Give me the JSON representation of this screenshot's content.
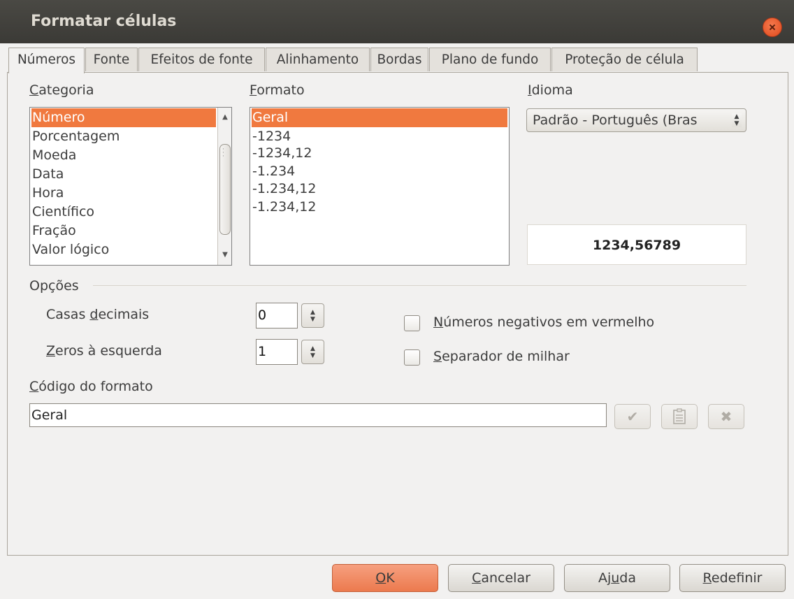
{
  "dialog": {
    "title": "Formatar células"
  },
  "tabs": [
    {
      "label": "Números",
      "active": true
    },
    {
      "label": "Fonte"
    },
    {
      "label": "Efeitos de fonte"
    },
    {
      "label": "Alinhamento"
    },
    {
      "label": "Bordas"
    },
    {
      "label": "Plano de fundo"
    },
    {
      "label": "Proteção de célula"
    }
  ],
  "categoria": {
    "label": "Categoria",
    "items": [
      "Número",
      "Porcentagem",
      "Moeda",
      "Data",
      "Hora",
      "Científico",
      "Fração",
      "Valor lógico"
    ],
    "selected": "Número"
  },
  "formato": {
    "label": "Formato",
    "items": [
      "Geral",
      "-1234",
      "-1234,12",
      "-1.234",
      "-1.234,12",
      "-1.234,12"
    ],
    "selected": "Geral"
  },
  "idioma": {
    "label": "Idioma",
    "value": "Padrão - Português (Bras"
  },
  "preview": {
    "value": "1234,56789"
  },
  "opcoes": {
    "label": "Opções",
    "casas_decimais": {
      "label": "Casas decimais",
      "value": "0"
    },
    "zeros_esquerda": {
      "label": "Zeros à esquerda",
      "value": "1"
    },
    "negativos_vermelho": {
      "label": "Números negativos em vermelho",
      "checked": false
    },
    "separador_milhar": {
      "label": "Separador de milhar",
      "checked": false
    }
  },
  "codigo": {
    "label": "Código do formato",
    "value": "Geral"
  },
  "buttons": {
    "ok": "OK",
    "cancelar": "Cancelar",
    "ajuda": "Ajuda",
    "redefinir": "Redefinir"
  },
  "icons": {
    "close": "close-icon",
    "accept": "checkmark-icon",
    "add_comment": "edit-comment-icon",
    "delete": "delete-icon"
  },
  "colors": {
    "titlebar": "#3f3e3a",
    "selection": "#f0793f",
    "ok_button": "#ee845a",
    "close_button": "#ea5a2a"
  }
}
